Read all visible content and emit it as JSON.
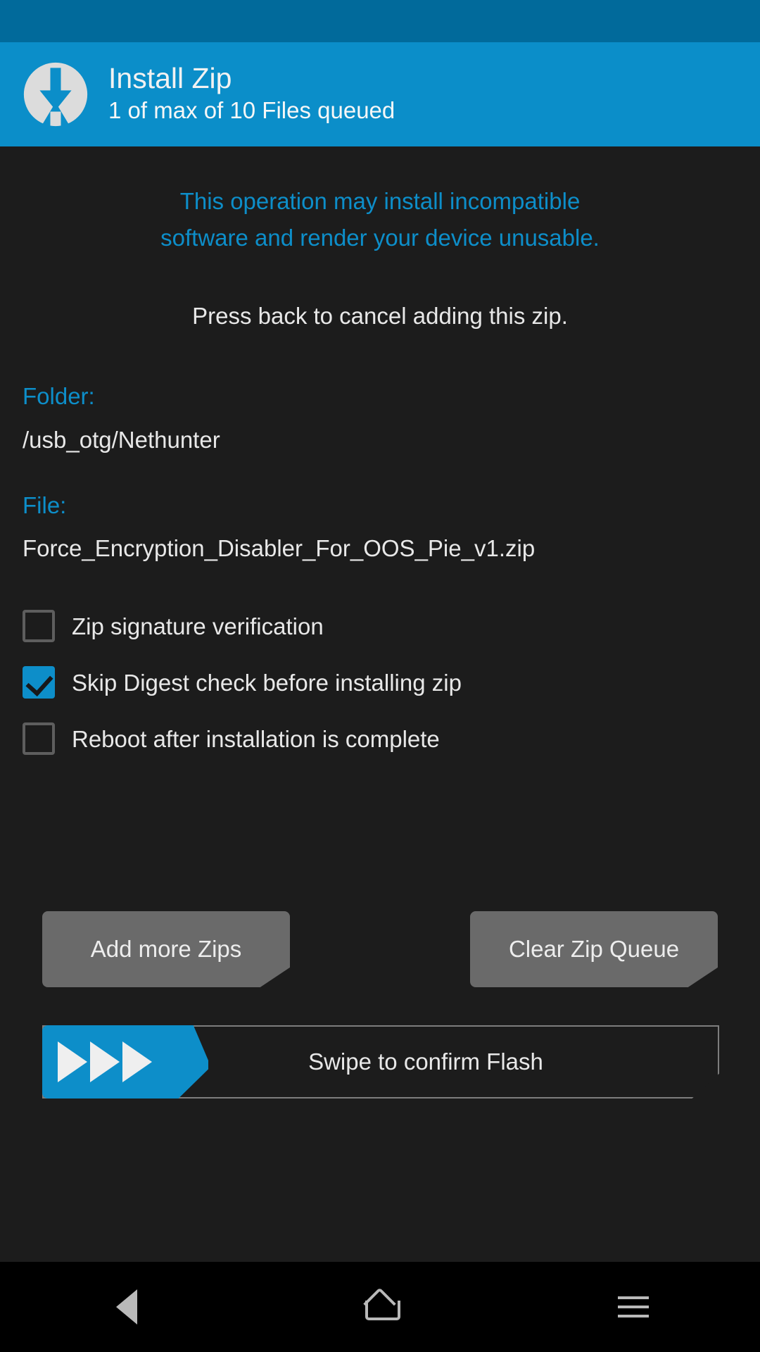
{
  "app": {
    "header": {
      "logo_icon": "twrp-logo-icon",
      "title": "Install Zip",
      "subtitle": "1 of max of 10 Files queued",
      "bg_color": "#0b8ec9",
      "status_bar_color": "#016a9b"
    },
    "warning": {
      "line1": "This operation may install incompatible",
      "line2": "software and render your device unusable.",
      "color": "#0d8ec9"
    },
    "press_back": "Press back to cancel adding this zip.",
    "fields": [
      {
        "label": "Folder:",
        "value": "/usb_otg/Nethunter"
      },
      {
        "label": "File:",
        "value": "Force_Encryption_Disabler_For_OOS_Pie_v1.zip"
      }
    ],
    "checkboxes": [
      {
        "label": "Zip signature verification",
        "checked": false
      },
      {
        "label": "Skip Digest check before installing zip",
        "checked": true
      },
      {
        "label": "Reboot after installation is complete",
        "checked": false
      }
    ],
    "buttons": [
      {
        "label": "Add more Zips"
      },
      {
        "label": "Clear Zip Queue"
      }
    ],
    "swipe": {
      "label": "Swipe to confirm Flash",
      "thumb_color": "#0d8ec9",
      "arrow_icon": "play-triangle-icon",
      "arrow_count": 3
    },
    "navbar": [
      {
        "icon": "back-triangle-icon"
      },
      {
        "icon": "home-icon"
      },
      {
        "icon": "menu-icon"
      }
    ],
    "colors": {
      "accent": "#0d8ec9",
      "background": "#1c1c1c",
      "button": "#6a6a6a",
      "text": "#e8e8e8"
    }
  }
}
